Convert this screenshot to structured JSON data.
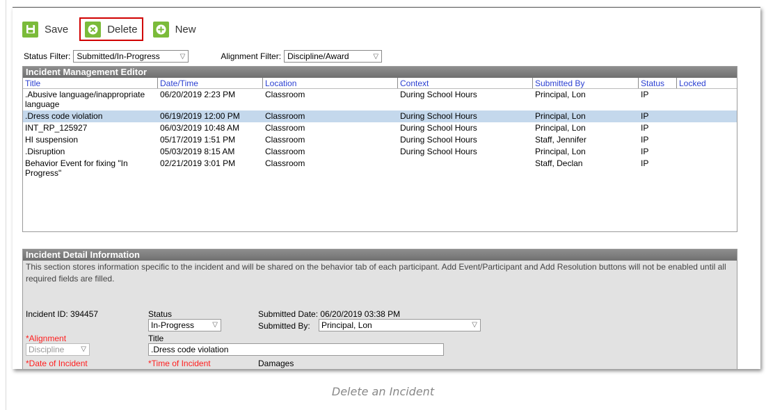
{
  "toolbar": {
    "save_label": "Save",
    "delete_label": "Delete",
    "new_label": "New"
  },
  "filters": {
    "status_label": "Status Filter:",
    "status_value": "Submitted/In-Progress",
    "alignment_label": "Alignment Filter:",
    "alignment_value": "Discipline/Award"
  },
  "editor": {
    "title": "Incident Management Editor",
    "columns": [
      "Title",
      "Date/Time",
      "Location",
      "Context",
      "Submitted By",
      "Status",
      "Locked"
    ],
    "rows": [
      [
        ".Abusive language/inappropriate language",
        "06/20/2019 2:23 PM",
        "Classroom",
        "During School Hours",
        "Principal, Lon",
        "IP",
        ""
      ],
      [
        ".Dress code violation",
        "06/19/2019 12:00 PM",
        "Classroom",
        "During School Hours",
        "Principal, Lon",
        "IP",
        ""
      ],
      [
        "INT_RP_125927",
        "06/03/2019 10:48 AM",
        "Classroom",
        "During School Hours",
        "Principal, Lon",
        "IP",
        ""
      ],
      [
        "HI suspension",
        "05/17/2019 1:51 PM",
        "Classroom",
        "During School Hours",
        "Staff, Jennifer",
        "IP",
        ""
      ],
      [
        ".Disruption",
        "05/03/2019 8:15 AM",
        "Classroom",
        "During School Hours",
        "Principal, Lon",
        "IP",
        ""
      ],
      [
        "Behavior Event for fixing \"In Progress\"",
        "02/21/2019 3:01 PM",
        "Classroom",
        "",
        "Staff, Declan",
        "IP",
        ""
      ]
    ]
  },
  "detail": {
    "title": "Incident Detail Information",
    "description": "This section stores information specific to the incident and will be shared on the behavior tab of each participant. Add Event/Participant and Add Resolution buttons will not be enabled until all required fields are filled.",
    "incident_id": "Incident ID: 394457",
    "status_label": "Status",
    "status_value": "In-Progress",
    "submitted_date": "Submitted Date: 06/20/2019 03:38 PM",
    "submitted_by_label": "Submitted By:",
    "submitted_by_value": "Principal, Lon",
    "alignment_label": "*Alignment",
    "alignment_value": "Discipline",
    "title_label": "Title",
    "title_value": ".Dress code violation",
    "date_label": "*Date of Incident",
    "time_label": "*Time of Incident",
    "damages_label": "Damages"
  },
  "caption": "Delete an Incident",
  "colors": {
    "accent_green": "#7bbb3a",
    "highlight_red": "#d00000",
    "header_blue": "#2a3fd1",
    "selected_row": "#c4d8ec"
  }
}
